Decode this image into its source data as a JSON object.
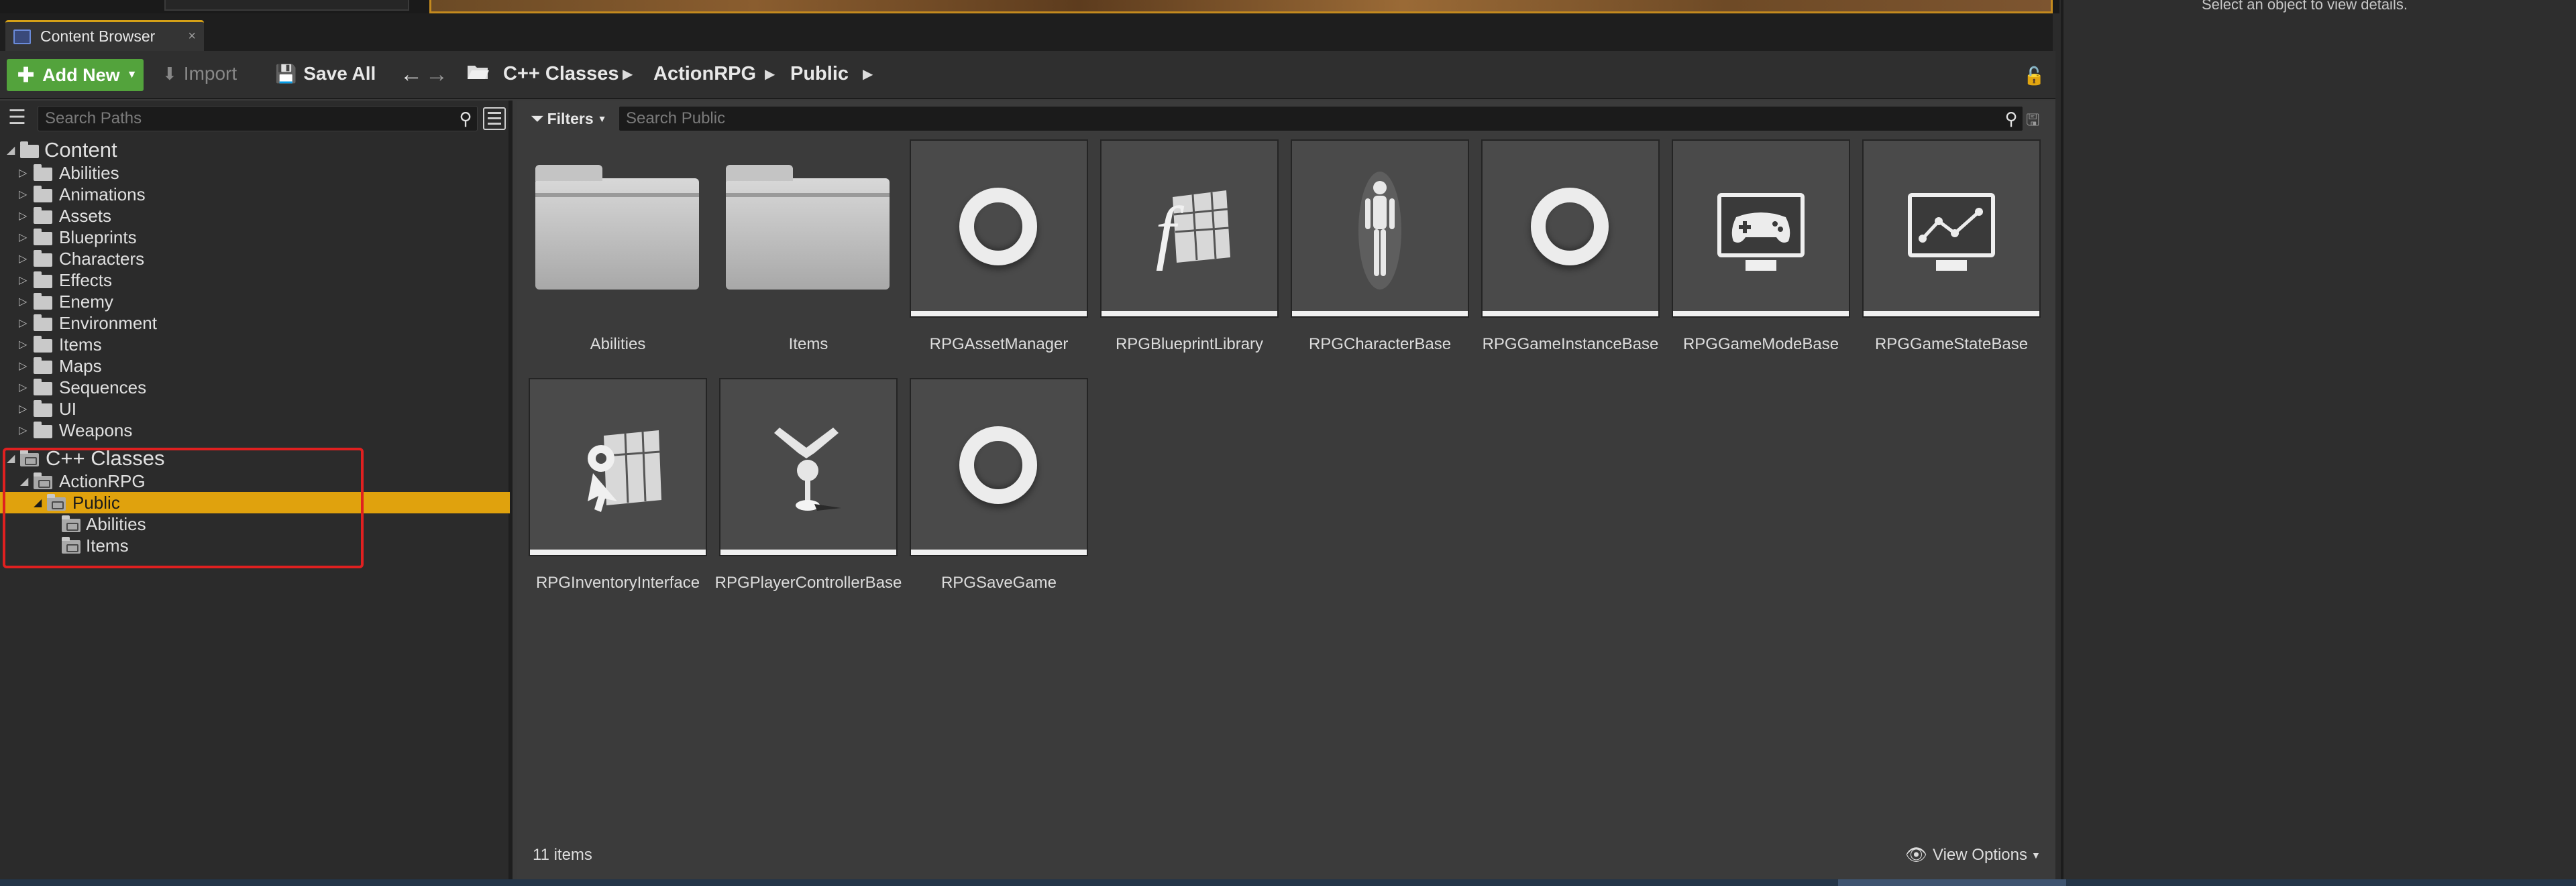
{
  "details_panel": {
    "hint": "Select an object to view details."
  },
  "tab": {
    "label": "Content Browser",
    "close": "×"
  },
  "toolbar": {
    "add_new_label": "Add New",
    "import_label": "Import",
    "save_all_label": "Save All"
  },
  "breadcrumbs": [
    "C++ Classes",
    "ActionRPG",
    "Public"
  ],
  "left_pane": {
    "search_placeholder": "Search Paths",
    "content_root": "Content",
    "content_folders": [
      "Abilities",
      "Animations",
      "Assets",
      "Blueprints",
      "Characters",
      "Effects",
      "Enemy",
      "Environment",
      "Items",
      "Maps",
      "Sequences",
      "UI",
      "Weapons"
    ],
    "cpp_root": "C++ Classes",
    "cpp_module": "ActionRPG",
    "cpp_selected": "Public",
    "cpp_children": [
      "Abilities",
      "Items"
    ]
  },
  "right_pane": {
    "filters_label": "Filters",
    "search_placeholder": "Search Public",
    "assets": [
      {
        "name": "Abilities",
        "kind": "folder"
      },
      {
        "name": "Items",
        "kind": "folder"
      },
      {
        "name": "RPGAssetManager",
        "kind": "class-ring"
      },
      {
        "name": "RPGBlueprintLibrary",
        "kind": "function-library"
      },
      {
        "name": "RPGCharacterBase",
        "kind": "character"
      },
      {
        "name": "RPGGameInstanceBase",
        "kind": "class-ring"
      },
      {
        "name": "RPGGameModeBase",
        "kind": "game-mode"
      },
      {
        "name": "RPGGameStateBase",
        "kind": "game-state"
      },
      {
        "name": "RPGInventoryInterface",
        "kind": "interface"
      },
      {
        "name": "RPGPlayerControllerBase",
        "kind": "player-controller"
      },
      {
        "name": "RPGSaveGame",
        "kind": "class-ring"
      }
    ],
    "item_count": "11 items",
    "view_options_label": "View Options"
  }
}
